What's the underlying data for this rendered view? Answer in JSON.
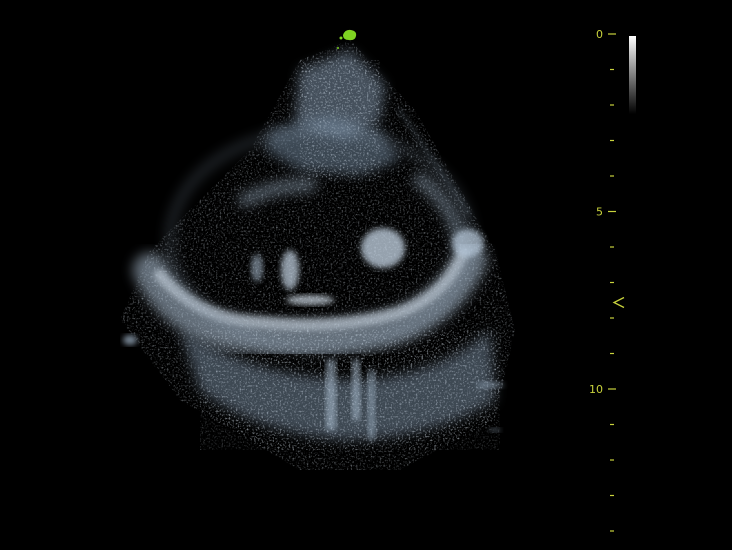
{
  "colors": {
    "background": "#000000",
    "scale_accent": "#c8d23c",
    "probe_marker": "#7ed321",
    "tissue_tint": "#b4c8dc"
  },
  "icons": {
    "probe_marker": "probe-orientation-marker-icon",
    "focus_marker": "focus-arrow-icon"
  },
  "depth_scale": {
    "labels": [
      {
        "value": 0,
        "text": "0"
      },
      {
        "value": 5,
        "text": "5"
      },
      {
        "value": 10,
        "text": "10"
      }
    ],
    "max_depth": 14,
    "minor_step": 1,
    "focus_depth": 7
  },
  "gray_map": {
    "from": "#ffffff",
    "to": "#000000"
  }
}
